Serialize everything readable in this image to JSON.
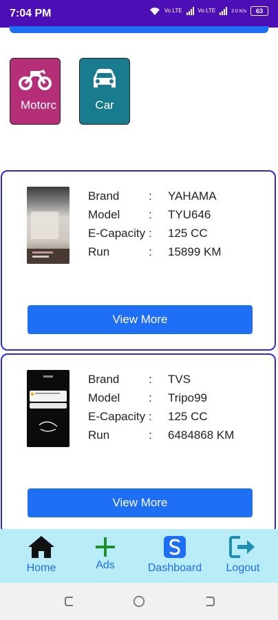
{
  "status_bar": {
    "time": "7:04 PM",
    "sim1": "Vo LTE",
    "sim2": "Vo LTE",
    "net_speed": "2.0 K/s",
    "battery": "63"
  },
  "categories": [
    {
      "label": "Motorc",
      "icon": "motorcycle-icon"
    },
    {
      "label": "Car",
      "icon": "car-icon"
    }
  ],
  "labels": {
    "brand": "Brand",
    "model": "Model",
    "capacity": "E-Capacity",
    "run": "Run",
    "colon": ":"
  },
  "listings": [
    {
      "brand": "YAHAMA",
      "model": "TYU646",
      "capacity": "125 CC",
      "run": "15899 KM",
      "button": "View More"
    },
    {
      "brand": "TVS",
      "model": "Tripo99",
      "capacity": "125 CC",
      "run": "6484868 KM",
      "button": "View More"
    }
  ],
  "bottom_nav": [
    {
      "label": "Home",
      "icon": "home-icon"
    },
    {
      "label": "Ads",
      "icon": "plus-icon"
    },
    {
      "label": "Dashboard",
      "icon": "dashboard-icon"
    },
    {
      "label": "Logout",
      "icon": "logout-icon"
    }
  ],
  "colors": {
    "status_bar": "#4b0fb5",
    "accent": "#1e6ff5",
    "moto_tile": "#b52e78",
    "car_tile": "#197c8e",
    "bottom_nav": "#b8ecf7"
  }
}
